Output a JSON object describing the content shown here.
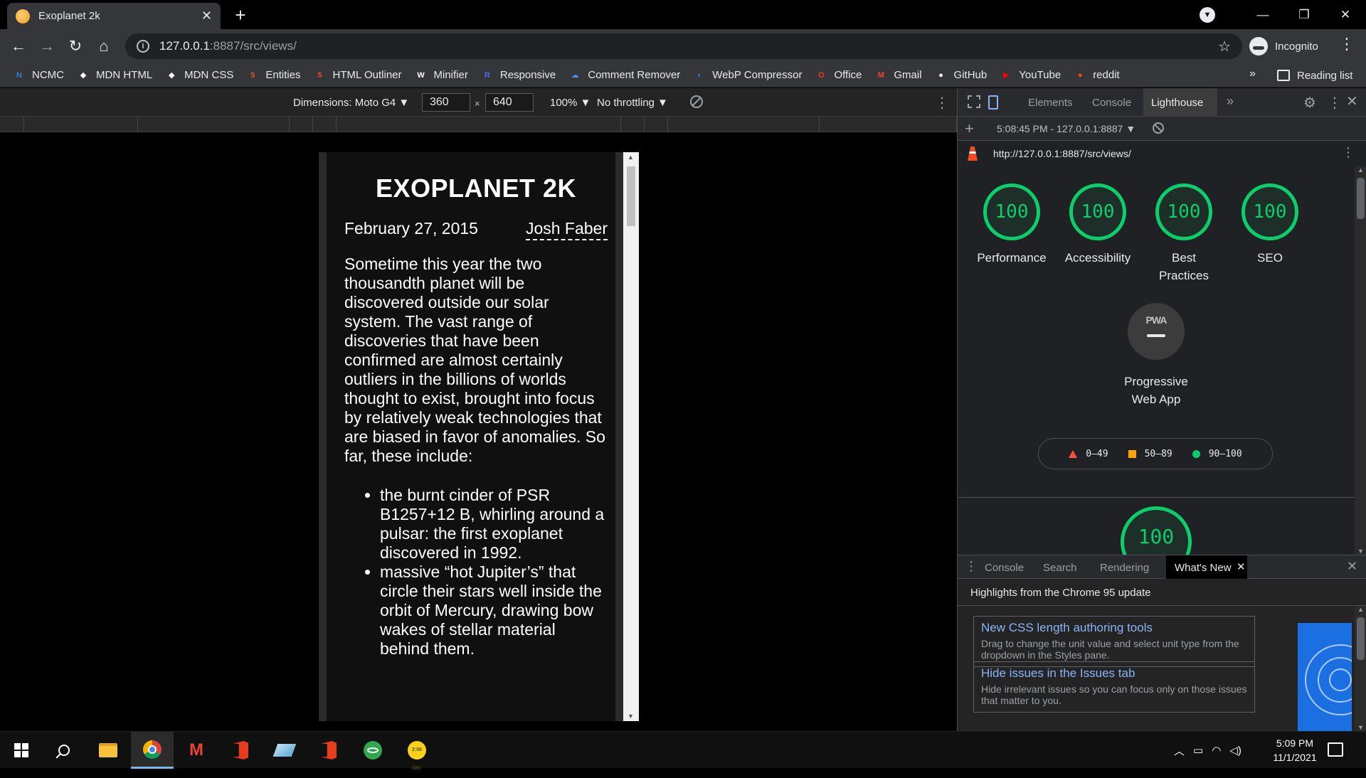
{
  "browser": {
    "tab_title": "Exoplanet 2k",
    "tab_close": "✕",
    "new_tab": "+",
    "window_controls": {
      "minimize": "—",
      "restore": "❐",
      "close": "✕"
    },
    "url_host": "127.0.0.1",
    "url_rest": ":8887/src/views/",
    "profile_label": "Incognito",
    "menu": "⋮"
  },
  "bookmarks": {
    "items": [
      {
        "label": "NCMC",
        "icon": "ncmc-icon",
        "color": "#3a7bd5"
      },
      {
        "label": "MDN HTML",
        "icon": "mdn-icon",
        "color": "#ffffff"
      },
      {
        "label": "MDN CSS",
        "icon": "mdn-icon",
        "color": "#ffffff"
      },
      {
        "label": "Entities",
        "icon": "html5-icon",
        "color": "#e44d26"
      },
      {
        "label": "HTML Outliner",
        "icon": "html5-icon",
        "color": "#e44d26"
      },
      {
        "label": "Minifier",
        "icon": "wordpress-icon",
        "color": "#ffffff"
      },
      {
        "label": "Responsive",
        "icon": "responsive-icon",
        "color": "#4a6cf7"
      },
      {
        "label": "Comment Remover",
        "icon": "cloud-icon",
        "color": "#4a8ff7"
      },
      {
        "label": "WebP Compressor",
        "icon": "webp-icon",
        "color": "#2c7be5"
      },
      {
        "label": "Office",
        "icon": "office-icon",
        "color": "#e83c1f"
      },
      {
        "label": "Gmail",
        "icon": "gmail-icon",
        "color": "#ea4335"
      },
      {
        "label": "GitHub",
        "icon": "github-icon",
        "color": "#ffffff"
      },
      {
        "label": "YouTube",
        "icon": "youtube-icon",
        "color": "#ff0000"
      },
      {
        "label": "reddit",
        "icon": "reddit-icon",
        "color": "#ff4500"
      }
    ],
    "more": "»",
    "reading_list": "Reading list"
  },
  "device_toolbar": {
    "dimensions_label": "Dimensions: Moto G4 ▼",
    "width": "360",
    "height": "640",
    "times": "×",
    "zoom": "100% ▼",
    "throttling": "No throttling ▼"
  },
  "article": {
    "title": "EXOPLANET 2K",
    "date": "February 27, 2015",
    "author": "Josh Faber",
    "body": "Sometime this year the two thousandth planet will be discovered outside our solar system. The vast range of discoveries that have been confirmed are almost certainly outliers in the billions of worlds thought to exist, brought into focus by relatively weak technologies that are biased in favor of anomalies. So far, these include:",
    "list": [
      "the burnt cinder of PSR B1257+12 B, whirling around a pulsar: the first exoplanet discovered in 1992.",
      "massive “hot Jupiter’s” that circle their stars well inside the orbit of Mercury, drawing bow wakes of stellar material behind them."
    ]
  },
  "devtools": {
    "tabs": [
      "Elements",
      "Console",
      "Lighthouse"
    ],
    "active_tab": "Lighthouse",
    "more_tabs": "»",
    "report_select": "5:08:45 PM - 127.0.0.1:8887 ▼",
    "report_url": "http://127.0.0.1:8887/src/views/",
    "scores": [
      {
        "label": "Performance",
        "value": "100"
      },
      {
        "label": "Accessibility",
        "value": "100"
      },
      {
        "label": "Best Practices",
        "value": "100"
      },
      {
        "label": "SEO",
        "value": "100"
      }
    ],
    "pwa": {
      "badge": "PWA",
      "label": "Progressive Web App"
    },
    "legend": [
      {
        "range": "0–49",
        "color": "#ff4e42"
      },
      {
        "range": "50–89",
        "color": "#ffa400"
      },
      {
        "range": "90–100",
        "color": "#0cce6b"
      }
    ],
    "big_score": "100",
    "drawer": {
      "tabs": [
        "Console",
        "Search",
        "Rendering",
        "What's New"
      ],
      "active_tab": "What's New",
      "heading": "Highlights from the Chrome 95 update",
      "cards": [
        {
          "title": "New CSS length authoring tools",
          "desc": "Drag to change the unit value and select unit type from the dropdown in the Styles pane."
        },
        {
          "title": "Hide issues in the Issues tab",
          "desc": "Hide irrelevant issues so you can focus only on those issues that matter to you."
        }
      ]
    }
  },
  "taskbar": {
    "time": "5:09 PM",
    "date": "11/1/2021",
    "clock_app_label": "2:00 OK!"
  }
}
